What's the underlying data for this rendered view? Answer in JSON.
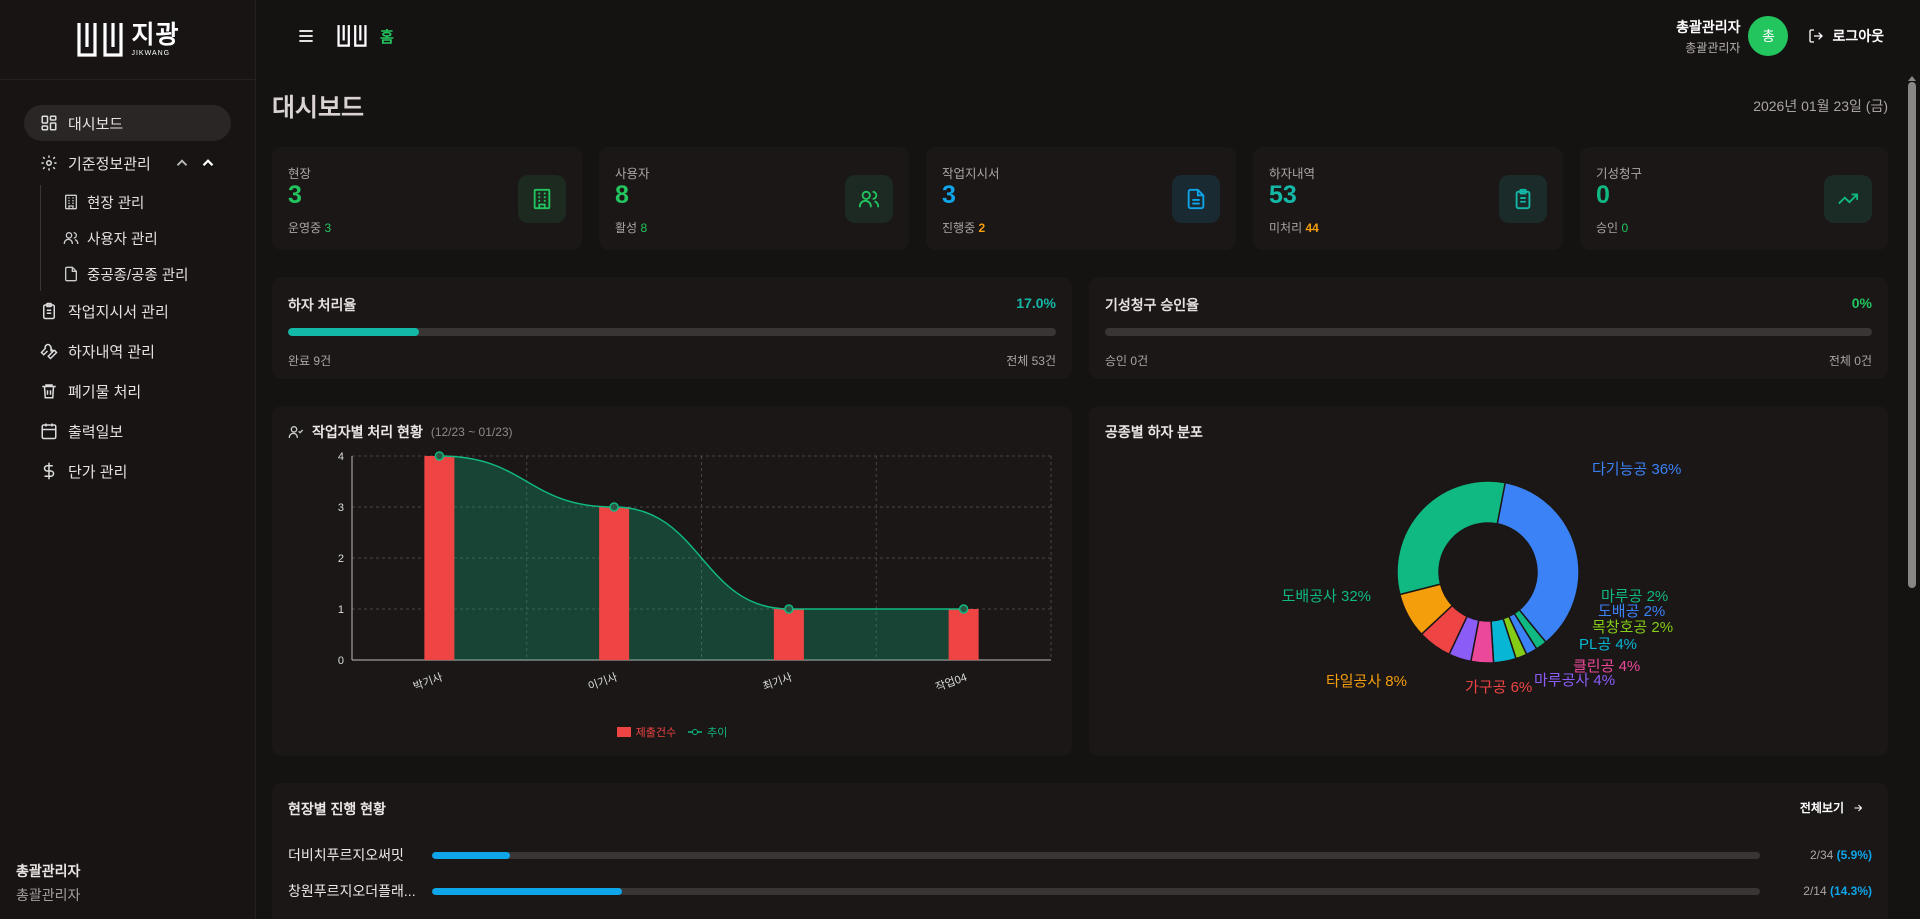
{
  "brand": {
    "name": "지광",
    "sub": "JIKWANG"
  },
  "topbar": {
    "home": "홈",
    "user_name": "총괄관리자",
    "user_role": "총괄관리자",
    "avatar_initial": "총",
    "logout": "로그아웃"
  },
  "sidebar": {
    "items": [
      {
        "label": "대시보드",
        "icon": "dashboard-icon"
      },
      {
        "label": "기준정보관리",
        "icon": "gear-icon"
      },
      {
        "label": "현장 관리",
        "icon": "building-icon"
      },
      {
        "label": "사용자 관리",
        "icon": "users-icon"
      },
      {
        "label": "중공종/공종 관리",
        "icon": "file-icon"
      },
      {
        "label": "작업지시서 관리",
        "icon": "clipboard-icon"
      },
      {
        "label": "하자내역 관리",
        "icon": "wrench-icon"
      },
      {
        "label": "폐기물 처리",
        "icon": "trash-icon"
      },
      {
        "label": "출력일보",
        "icon": "calendar-icon"
      },
      {
        "label": "단가 관리",
        "icon": "dollar-icon"
      }
    ],
    "footer_name": "총괄관리자",
    "footer_role": "총괄관리자"
  },
  "page": {
    "title": "대시보드",
    "date": "2026년 01월 23일 (금)"
  },
  "stats": [
    {
      "label": "현장",
      "value": "3",
      "sub_label": "운영중",
      "sub_value": "3",
      "color": "#22c55e",
      "sub_color": "#22c55e",
      "icon": "building-icon"
    },
    {
      "label": "사용자",
      "value": "8",
      "sub_label": "활성",
      "sub_value": "8",
      "color": "#22c55e",
      "sub_color": "#22c55e",
      "icon": "users-icon"
    },
    {
      "label": "작업지시서",
      "value": "3",
      "sub_label": "진행중",
      "sub_value": "2",
      "color": "#0ea5e9",
      "sub_color": "#f59e0b",
      "icon": "file-icon"
    },
    {
      "label": "하자내역",
      "value": "53",
      "sub_label": "미처리",
      "sub_value": "44",
      "color": "#14b8a6",
      "sub_color": "#f59e0b",
      "icon": "clipboard-icon"
    },
    {
      "label": "기성청구",
      "value": "0",
      "sub_label": "승인",
      "sub_value": "0",
      "color": "#10b981",
      "sub_color": "#22c55e",
      "icon": "trend-up-icon"
    }
  ],
  "rates": [
    {
      "title": "하자 처리율",
      "percent_text": "17.0%",
      "progress": 0.17,
      "left": "완료 9건",
      "right": "전체 53건",
      "color": "#14b8a6"
    },
    {
      "title": "기성청구 승인율",
      "percent_text": "0%",
      "progress": 0,
      "left": "승인 0건",
      "right": "전체 0건",
      "color": "#22c55e"
    }
  ],
  "worker_panel": {
    "title": "작업자별 처리 현황",
    "range": "(12/23 ~ 01/23)"
  },
  "chart_data": [
    {
      "type": "bar",
      "categories": [
        "박기사",
        "이기사",
        "최기사",
        "작업04"
      ],
      "series": [
        {
          "name": "제출건수",
          "values": [
            4,
            3,
            1,
            1
          ],
          "color": "#ef4444"
        },
        {
          "name": "추이",
          "values": [
            4,
            3,
            1,
            1
          ],
          "color": "#10b981",
          "type": "area"
        }
      ],
      "ylim": [
        0,
        4
      ],
      "yticks": [
        "0",
        "1",
        "2",
        "3",
        "4"
      ],
      "grid": true,
      "legend": "bottom"
    },
    {
      "type": "pie",
      "title": "공종별 하자 분포",
      "slices": [
        {
          "label": "다기능공 36%",
          "value": 36,
          "color": "#3b82f6"
        },
        {
          "label": "마루공 2%",
          "value": 2,
          "color": "#10b981"
        },
        {
          "label": "도배공 2%",
          "value": 2,
          "color": "#3b82f6"
        },
        {
          "label": "목창호공 2%",
          "value": 2,
          "color": "#84cc16"
        },
        {
          "label": "PL공 4%",
          "value": 4,
          "color": "#06b6d4"
        },
        {
          "label": "클린공 4%",
          "value": 4,
          "color": "#ec4899"
        },
        {
          "label": "마루공사 4%",
          "value": 4,
          "color": "#8b5cf6"
        },
        {
          "label": "가구공 6%",
          "value": 6,
          "color": "#ef4444"
        },
        {
          "label": "타일공사 8%",
          "value": 8,
          "color": "#f59e0b"
        },
        {
          "label": "도배공사 32%",
          "value": 32,
          "color": "#10b981"
        }
      ]
    }
  ],
  "site_progress": {
    "title": "현장별 진행 현황",
    "view_all": "전체보기",
    "rows": [
      {
        "name": "더비치푸르지오써밋",
        "count": "2/34",
        "pct": "(5.9%)",
        "progress": 0.059
      },
      {
        "name": "창원푸르지오더플래...",
        "count": "2/14",
        "pct": "(14.3%)",
        "progress": 0.143
      }
    ]
  }
}
